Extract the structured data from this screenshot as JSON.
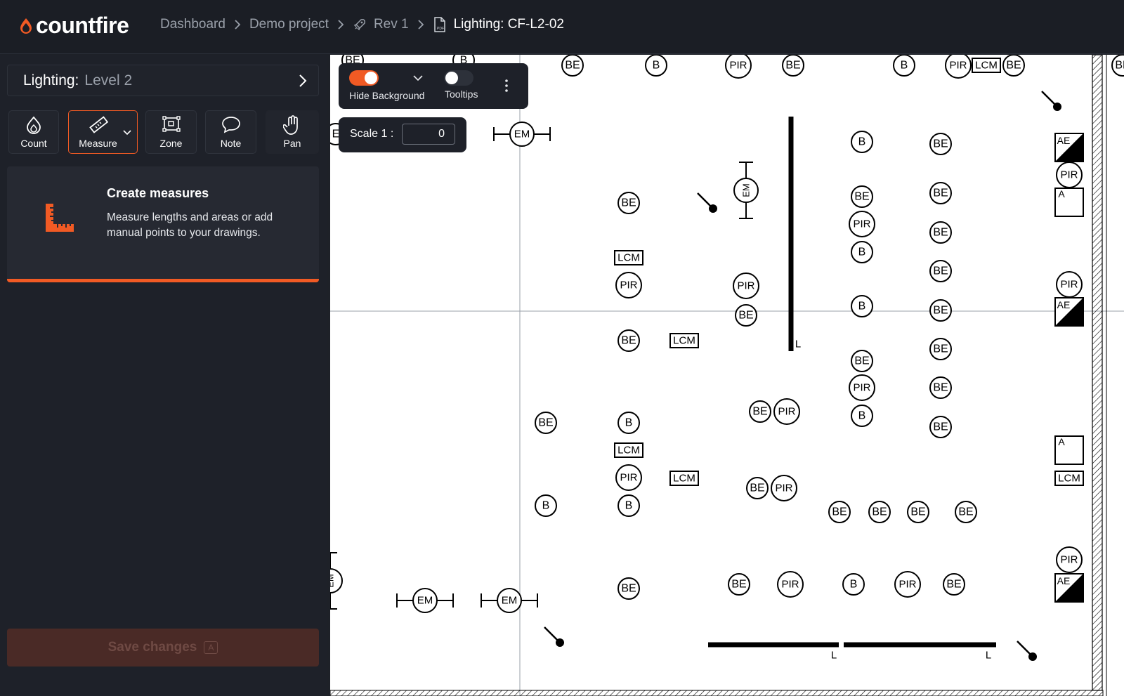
{
  "app": {
    "brand": "countfire",
    "accent_color": "#f15a24"
  },
  "breadcrumb": [
    {
      "label": "Dashboard",
      "icon": null
    },
    {
      "label": "Demo project",
      "icon": null
    },
    {
      "label": "Rev 1",
      "icon": "rocket-icon"
    },
    {
      "label": "Lighting: CF-L2-02",
      "icon": "pdf-file-icon"
    }
  ],
  "sidebar": {
    "level_prefix": "Lighting:",
    "level_name": "Level 2",
    "tools": [
      {
        "label": "Count",
        "icon": "flame-icon"
      },
      {
        "label": "Measure",
        "icon": "ruler-icon",
        "active": true
      },
      {
        "label": "Zone",
        "icon": "zone-icon"
      },
      {
        "label": "Note",
        "icon": "speech-bubble-icon"
      },
      {
        "label": "Pan",
        "icon": "hand-icon"
      }
    ],
    "info": {
      "title": "Create measures",
      "text": "Measure lengths and areas or add manual points to your drawings."
    },
    "save": {
      "label": "Save changes",
      "shortcut": "A"
    }
  },
  "viewer": {
    "hide_background_label": "Hide Background",
    "hide_background_on": true,
    "tooltips_label": "Tooltips",
    "tooltips_on": false,
    "scale_label": "Scale 1 :",
    "scale_value": "0"
  },
  "drawing": {
    "symbols": [
      "BE",
      "B",
      "PIR",
      "LCM",
      "EM",
      "AE",
      "A",
      "L"
    ]
  }
}
